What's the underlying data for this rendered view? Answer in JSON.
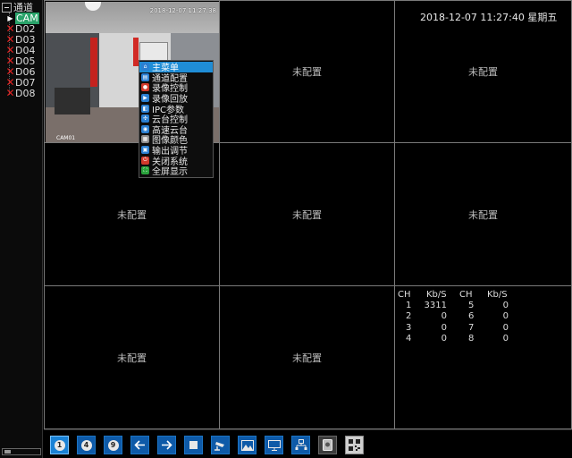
{
  "sidebar": {
    "root_label": "通道",
    "active_channel": "CAM",
    "channels": [
      "D02",
      "D03",
      "D04",
      "D05",
      "D06",
      "D07",
      "D08"
    ]
  },
  "camera": {
    "timestamp": "2018-12-07 11:27:38",
    "label": "CAM01"
  },
  "menu": {
    "items": [
      "主菜单",
      "通道配置",
      "录像控制",
      "录像回放",
      "IPC参数",
      "云台控制",
      "高速云台",
      "图像颜色",
      "输出调节",
      "关闭系统",
      "全屏显示"
    ],
    "selected_index": 0
  },
  "grid": {
    "not_configured": "未配置"
  },
  "clock": "2018-12-07 11:27:40 星期五",
  "stats": {
    "headers": [
      "CH",
      "Kb/S",
      "CH",
      "Kb/S"
    ],
    "rows": [
      [
        "1",
        "3311",
        "5",
        "0"
      ],
      [
        "2",
        "0",
        "6",
        "0"
      ],
      [
        "3",
        "0",
        "7",
        "0"
      ],
      [
        "4",
        "0",
        "8",
        "0"
      ]
    ]
  },
  "toolbar": {
    "buttons": [
      "1",
      "4",
      "9",
      "prev",
      "next",
      "stop",
      "ptz",
      "image",
      "monitor",
      "network",
      "disk",
      "qr"
    ]
  },
  "colors": {
    "accent": "#1f8dd6",
    "error_x": "#e02020",
    "active_channel": "#2aa36a"
  }
}
